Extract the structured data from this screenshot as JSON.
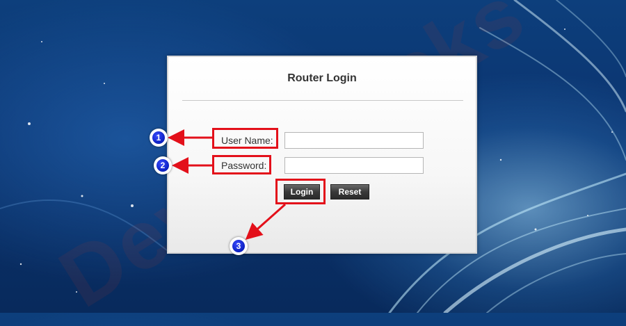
{
  "background": {
    "watermark_text": "DeviceTricks",
    "colors": {
      "deep_blue": "#0b3470",
      "light_blue": "#9fd8ff"
    }
  },
  "login_panel": {
    "title": "Router Login",
    "username_label": "User Name:",
    "username_value": "",
    "password_label": "Password:",
    "password_value": "",
    "login_button": "Login",
    "reset_button": "Reset"
  },
  "annotations": {
    "color": "#e3101a",
    "callouts": [
      "1",
      "2",
      "3"
    ]
  }
}
